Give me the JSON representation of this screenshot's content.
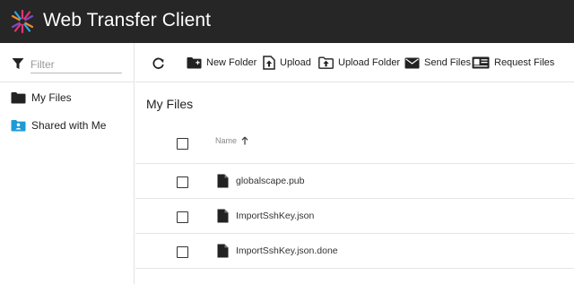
{
  "header": {
    "title": "Web Transfer Client",
    "logo_icon": "globalscape-star-icon"
  },
  "sidebar": {
    "filter_placeholder": "Filter",
    "filter_value": "",
    "items": [
      {
        "label": "My Files",
        "icon": "folder-icon",
        "color": "#222222"
      },
      {
        "label": "Shared with Me",
        "icon": "shared-folder-icon",
        "color": "#1e9ad6"
      }
    ]
  },
  "toolbar": {
    "refresh_icon": "refresh-icon",
    "buttons": [
      {
        "label": "New Folder",
        "icon": "new-folder-icon"
      },
      {
        "label": "Upload",
        "icon": "upload-icon"
      },
      {
        "label": "Upload Folder",
        "icon": "upload-folder-icon"
      },
      {
        "label": "Send Files",
        "icon": "envelope-icon"
      },
      {
        "label": "Request Files",
        "icon": "request-card-icon"
      }
    ]
  },
  "main": {
    "title": "My Files",
    "table": {
      "column_name": "Name",
      "sort": "ascending",
      "rows": [
        {
          "name": "globalscape.pub"
        },
        {
          "name": "ImportSshKey.json"
        },
        {
          "name": "ImportSshKey.json.done"
        }
      ]
    }
  }
}
